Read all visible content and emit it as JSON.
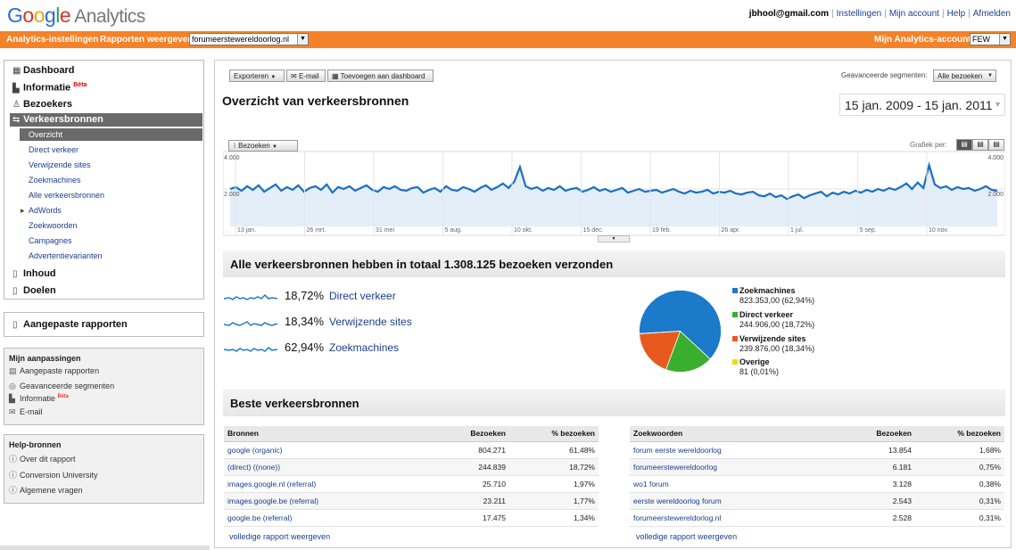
{
  "header": {
    "logo_google": "Google",
    "logo_analytics": "Analytics",
    "user_email": "jbhool@gmail.com",
    "links": [
      "Instellingen",
      "Mijn account",
      "Help",
      "Afmelden"
    ]
  },
  "orangebar": {
    "settings_label": "Analytics-instellingen",
    "reports_label": "Rapporten weergeven:",
    "profile_value": "forumeerstewereldoorlog.nl",
    "accounts_label": "Mijn Analytics-accounts:",
    "accounts_value": "FEW"
  },
  "nav": {
    "dashboard": "Dashboard",
    "informatie": "Informatie",
    "beta": "Bèta",
    "bezoekers": "Bezoekers",
    "verkeersbronnen": "Verkeersbronnen",
    "subitems": [
      "Overzicht",
      "Direct verkeer",
      "Verwijzende sites",
      "Zoekmachines",
      "Alle verkeersbronnen",
      "AdWords",
      "Zoekwoorden",
      "Campagnes",
      "Advertentievarianten"
    ],
    "inhoud": "Inhoud",
    "doelen": "Doelen"
  },
  "custom_reports": "Aangepaste rapporten",
  "my_adjustments": {
    "title": "Mijn aanpassingen",
    "items": [
      "Aangepaste rapporten",
      "Geavanceerde segmenten",
      "Informatie",
      "E-mail"
    ],
    "beta": "Bèta"
  },
  "help": {
    "title": "Help-bronnen",
    "items": [
      "Over dit rapport",
      "Conversion University",
      "Algemene vragen"
    ]
  },
  "toolbar": {
    "export": "Exporteren",
    "email": "E-mail",
    "add_dashboard": "Toevoegen aan dashboard",
    "segments_label": "Geavanceerde segmenten:",
    "segments_value": "Alle bezoeken"
  },
  "page": {
    "title": "Overzicht van verkeersbronnen",
    "daterange": "15 jan. 2009 - 15 jan. 2011",
    "graph_label": "Grafiek per:"
  },
  "chart_data": {
    "type": "line",
    "metric_selector": "Bezoeken",
    "y_tick_top": "4.000",
    "y_tick_mid": "2.000",
    "y_tick_right_top": "4.000",
    "y_tick_right_mid": "2.000",
    "ylim": [
      0,
      4000
    ],
    "x_tick_labels": [
      "13 jan.",
      "26 mrt.",
      "31 mei",
      "5 aug.",
      "10 okt.",
      "15 dec.",
      "19 feb.",
      "26 apr.",
      "1 jul.",
      "5 sep.",
      "10 nov."
    ],
    "series": [
      {
        "values": [
          2050,
          2150,
          1950,
          2200,
          2000,
          2250,
          1900,
          2100,
          2300,
          1950,
          2150,
          2000,
          2250,
          1900,
          2100,
          2200,
          2000,
          2300,
          1850,
          2150,
          2050,
          2200,
          1950,
          2100,
          2250,
          2000,
          1900,
          2150,
          2050,
          2200,
          2000,
          1950,
          2100,
          2150,
          1850,
          2000,
          2100,
          1900,
          2200,
          2000,
          1950,
          2150,
          2050,
          1900,
          2100,
          2250,
          2000,
          2150,
          2350,
          2100,
          2450,
          3250,
          2200,
          2050,
          2150,
          1950,
          2100,
          2000,
          2200,
          1950,
          2050,
          2100,
          1900,
          2000,
          2150,
          1950,
          2050,
          1900,
          2000,
          2100,
          1850,
          1950,
          2050,
          1900,
          1950,
          2000,
          1850,
          1950,
          2050,
          1900,
          1800,
          1950,
          1850,
          1900,
          2000,
          1800,
          1900,
          1850,
          1950,
          1800,
          1750,
          1850,
          1900,
          1700,
          1650,
          1800,
          1600,
          1700,
          1500,
          1650,
          1750,
          1550,
          1700,
          1800,
          1900,
          1650,
          1850,
          1750,
          1900,
          1800,
          1950,
          1850,
          2000,
          1900,
          2050,
          1950,
          2100,
          2000,
          2150,
          2350,
          2050,
          2400,
          2100,
          3350,
          2300,
          2100,
          2200,
          2000,
          2150,
          2050,
          2100,
          1950,
          2050,
          2200,
          2000,
          1950
        ]
      }
    ]
  },
  "totals": {
    "heading": "Alle verkeersbronnen hebben in totaal 1.308.125 bezoeken verzonden",
    "rows": [
      {
        "pct": "18,72%",
        "label": "Direct verkeer"
      },
      {
        "pct": "18,34%",
        "label": "Verwijzende sites"
      },
      {
        "pct": "62,94%",
        "label": "Zoekmachines"
      }
    ]
  },
  "pie": {
    "slices": [
      {
        "name": "Zoekmachines",
        "value": 62.94,
        "value_text": "823.353,00 (62,94%)",
        "color": "#1b7ac9"
      },
      {
        "name": "Direct verkeer",
        "value": 18.72,
        "value_text": "244.906,00 (18,72%)",
        "color": "#39ae2f"
      },
      {
        "name": "Verwijzende sites",
        "value": 18.34,
        "value_text": "239.876,00 (18,34%)",
        "color": "#e8591f"
      },
      {
        "name": "Overige",
        "value": 0.01,
        "value_text": "81 (0,01%)",
        "color": "#f5d800"
      }
    ]
  },
  "best": {
    "heading": "Beste verkeersbronnen",
    "sources_headers": [
      "Bronnen",
      "Bezoeken",
      "% bezoeken"
    ],
    "sources_rows": [
      [
        "google (organic)",
        "804.271",
        "61,48%"
      ],
      [
        "(direct) ((none))",
        "244.839",
        "18,72%"
      ],
      [
        "images.google.nl (referral)",
        "25.710",
        "1,97%"
      ],
      [
        "images.google.be (referral)",
        "23.211",
        "1,77%"
      ],
      [
        "google.be (referral)",
        "17.475",
        "1,34%"
      ]
    ],
    "keywords_headers": [
      "Zoekwoorden",
      "Bezoeken",
      "% bezoeken"
    ],
    "keywords_rows": [
      [
        "forum eerste wereldoorlog",
        "13.854",
        "1,68%"
      ],
      [
        "forumeerstewereldoorlog",
        "6.181",
        "0,75%"
      ],
      [
        "wo1 forum",
        "3.128",
        "0,38%"
      ],
      [
        "eerste wereldoorlog forum",
        "2.543",
        "0,31%"
      ],
      [
        "forumeerstewereldorlog.nl",
        "2.528",
        "0,31%"
      ]
    ],
    "full_report": "volledige rapport weergeven"
  }
}
